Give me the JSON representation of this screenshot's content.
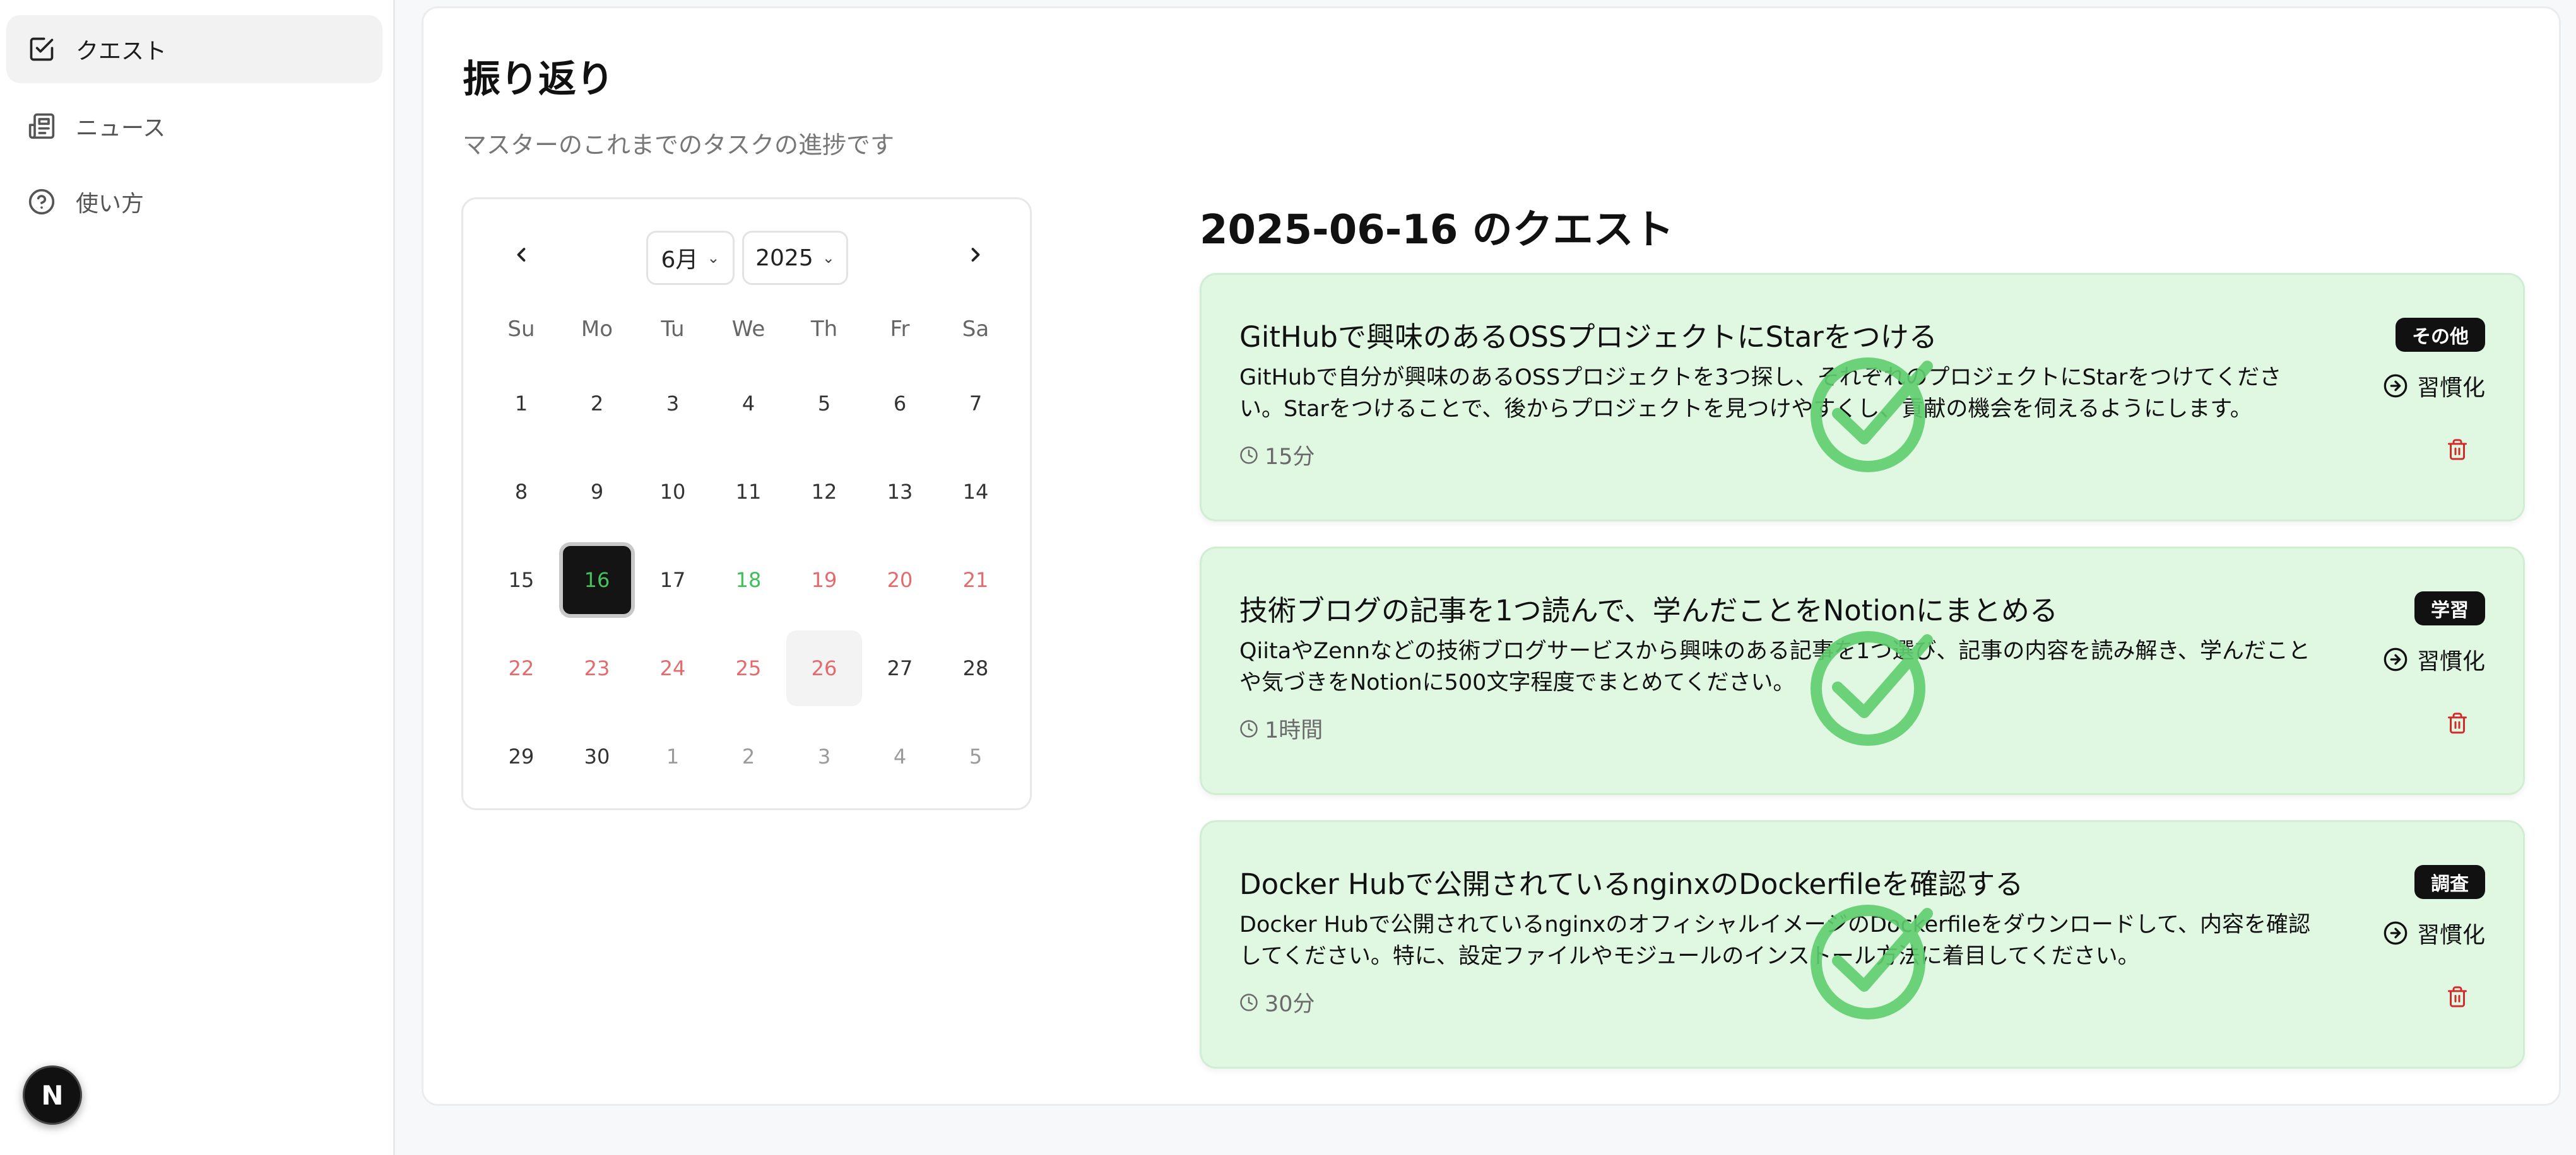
{
  "sidebar": {
    "items": [
      {
        "label": "クエスト",
        "icon": "check-square-icon",
        "active": true
      },
      {
        "label": "ニュース",
        "icon": "newspaper-icon",
        "active": false
      },
      {
        "label": "使い方",
        "icon": "help-circle-icon",
        "active": false
      }
    ],
    "avatar_letter": "N"
  },
  "header": {
    "title": "振り返り",
    "subtitle": "マスターのこれまでのタスクの進捗です"
  },
  "calendar": {
    "month_select": "6月",
    "year_select": "2025",
    "prev_icon": "chevron-left-icon",
    "next_icon": "chevron-right-icon",
    "weekdays": [
      "Su",
      "Mo",
      "Tu",
      "We",
      "Th",
      "Fr",
      "Sa"
    ],
    "weeks": [
      [
        "1",
        "2",
        "3",
        "4",
        "5",
        "6",
        "7"
      ],
      [
        "8",
        "9",
        "10",
        "11",
        "12",
        "13",
        "14"
      ],
      [
        "15",
        "16",
        "17",
        "18",
        "19",
        "20",
        "21"
      ],
      [
        "22",
        "23",
        "24",
        "25",
        "26",
        "27",
        "28"
      ],
      [
        "29",
        "30",
        "1",
        "2",
        "3",
        "4",
        "5"
      ]
    ],
    "selected_date": "16",
    "colors": {
      "done": "#3fbf5a",
      "missed": "#e46b6b",
      "outside": "#9a9a9a"
    }
  },
  "quests": {
    "heading": "2025-06-16 のクエスト",
    "habit_label": "習慣化",
    "items": [
      {
        "title": "GitHubで興味のあるOSSプロジェクトにStarをつける",
        "description": "GitHubで自分が興味のあるOSSプロジェクトを3つ探し、それぞれのプロジェクトにStarをつけてください。Starをつけることで、後からプロジェクトを見つけやすくし、貢献の機会を伺えるようにします。",
        "time": "15分",
        "tag": "その他",
        "completed": true
      },
      {
        "title": "技術ブログの記事を1つ読んで、学んだことをNotionにまとめる",
        "description": "QiitaやZennなどの技術ブログサービスから興味のある記事を1つ選び、記事の内容を読み解き、学んだことや気づきをNotionに500文字程度でまとめてください。",
        "time": "1時間",
        "tag": "学習",
        "completed": true
      },
      {
        "title": "Docker Hubで公開されているnginxのDockerfileを確認する",
        "description": "Docker Hubで公開されているnginxのオフィシャルイメージのDockerfileをダウンロードして、内容を確認してください。特に、設定ファイルやモジュールのインストール方法に着目してください。",
        "time": "30分",
        "tag": "調査",
        "completed": true
      }
    ]
  }
}
